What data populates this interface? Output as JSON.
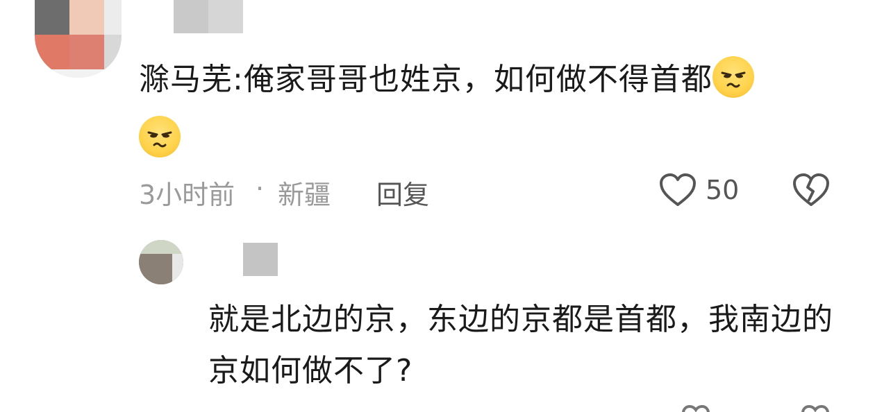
{
  "comment": {
    "text": "滁马芜:俺家哥哥也姓京，如何做不得首都",
    "emoji_1": "smirk-emoji",
    "emoji_2": "smirk-emoji",
    "time": "3小时前",
    "separator": "·",
    "location": "新疆",
    "reply_label": "回复",
    "like_count": "50"
  },
  "reply": {
    "text": "就是北边的京，东边的京都是首都，我南边的京如何做不了?"
  },
  "colors": {
    "text_primary": "#1a1a1a",
    "text_secondary": "#9a9a9a",
    "emoji_yellow": "#ffd24a"
  }
}
